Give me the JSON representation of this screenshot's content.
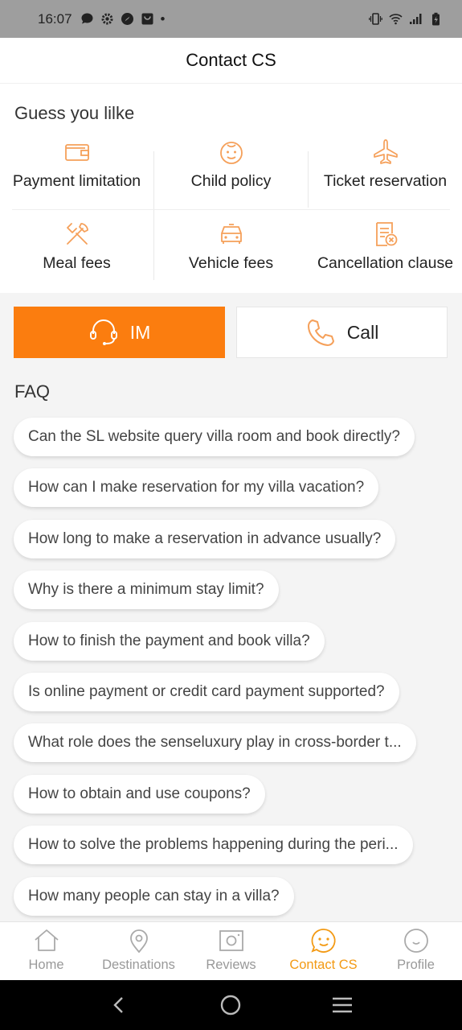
{
  "status_bar": {
    "time": "16:07",
    "dot": "•"
  },
  "header": {
    "title": "Contact CS"
  },
  "guess": {
    "title": "Guess you lilke",
    "items": [
      {
        "label": "Payment limitation",
        "icon": "wallet-icon"
      },
      {
        "label": "Child policy",
        "icon": "child-face-icon"
      },
      {
        "label": "Ticket reservation",
        "icon": "airplane-icon"
      },
      {
        "label": "Meal fees",
        "icon": "fork-knife-icon"
      },
      {
        "label": "Vehicle fees",
        "icon": "car-icon"
      },
      {
        "label": "Cancellation clause",
        "icon": "cancel-document-icon"
      }
    ]
  },
  "actions": {
    "im_label": "IM",
    "call_label": "Call"
  },
  "faq": {
    "title": "FAQ",
    "items": [
      "Can the SL website query villa room and book directly?",
      "How can I make reservation for my villa vacation?",
      "How long to make a reservation in advance usually?",
      "Why is there a minimum stay limit?",
      "How to finish the payment and book villa?",
      "Is online payment or credit card payment supported?",
      "What role does the senseluxury play in cross-border t...",
      "How to obtain and use coupons?",
      "How to solve the problems happening during the peri...",
      "How many people can stay in a villa?"
    ]
  },
  "tabs": [
    {
      "label": "Home",
      "icon": "home-icon"
    },
    {
      "label": "Destinations",
      "icon": "location-pin-icon"
    },
    {
      "label": "Reviews",
      "icon": "camera-icon"
    },
    {
      "label": "Contact CS",
      "icon": "smile-chat-icon",
      "active": true
    },
    {
      "label": "Profile",
      "icon": "profile-smile-icon"
    }
  ],
  "colors": {
    "accent": "#fb7d0f",
    "active_tab": "#f39a14",
    "icon_orange": "#f5a05a"
  }
}
